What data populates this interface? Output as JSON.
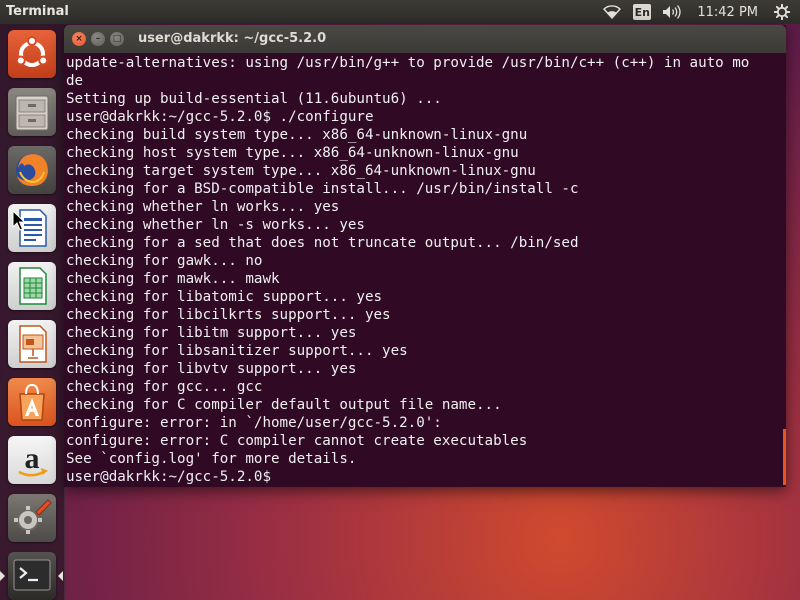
{
  "top_panel": {
    "app_title": "Terminal",
    "language": "En",
    "clock": "11:42 PM",
    "icons": [
      "wifi-icon",
      "volume-icon",
      "power-settings-icon"
    ]
  },
  "launcher": {
    "items": [
      "ubuntu-dash-icon",
      "files-icon",
      "firefox-icon",
      "libreoffice-writer-icon",
      "libreoffice-calc-icon",
      "libreoffice-impress-icon",
      "software-center-icon",
      "amazon-icon",
      "system-settings-icon",
      "terminal-icon"
    ]
  },
  "window": {
    "title": "user@dakrkk: ~/gcc-5.2.0",
    "close_symbol": "×",
    "minimize_symbol": "–",
    "maximize_symbol": "□"
  },
  "terminal": {
    "lines": [
      "update-alternatives: using /usr/bin/g++ to provide /usr/bin/c++ (c++) in auto mo",
      "de",
      "Setting up build-essential (11.6ubuntu6) ...",
      "user@dakrkk:~/gcc-5.2.0$ ./configure",
      "checking build system type... x86_64-unknown-linux-gnu",
      "checking host system type... x86_64-unknown-linux-gnu",
      "checking target system type... x86_64-unknown-linux-gnu",
      "checking for a BSD-compatible install... /usr/bin/install -c",
      "checking whether ln works... yes",
      "checking whether ln -s works... yes",
      "checking for a sed that does not truncate output... /bin/sed",
      "checking for gawk... no",
      "checking for mawk... mawk",
      "checking for libatomic support... yes",
      "checking for libcilkrts support... yes",
      "checking for libitm support... yes",
      "checking for libsanitizer support... yes",
      "checking for libvtv support... yes",
      "checking for gcc... gcc",
      "checking for C compiler default output file name...",
      "configure: error: in `/home/user/gcc-5.2.0':",
      "configure: error: C compiler cannot create executables",
      "See `config.log' for more details.",
      "user@dakrkk:~/gcc-5.2.0$"
    ]
  },
  "colors": {
    "terminal_bg": "#300a24",
    "terminal_fg": "#f0f0f0",
    "accent": "#e95420"
  }
}
